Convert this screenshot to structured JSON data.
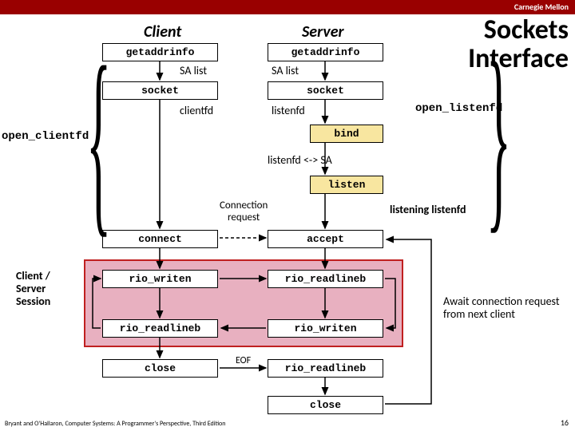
{
  "branding": "Carnegie Mellon",
  "title_line1": "Sockets",
  "title_line2": "Interface",
  "headers": {
    "client": "Client",
    "server": "Server"
  },
  "boxes": {
    "c_gai": "getaddrinfo",
    "s_gai": "getaddrinfo",
    "c_sock": "socket",
    "s_sock": "socket",
    "c_connect": "connect",
    "s_bind": "bind",
    "s_listen": "listen",
    "s_accept": "accept",
    "c_writen": "rio_writen",
    "s_readline1": "rio_readlineb",
    "c_readline": "rio_readlineb",
    "s_writen": "rio_writen",
    "c_close": "close",
    "s_readline2": "rio_readlineb",
    "s_close": "close"
  },
  "labels": {
    "sa_list_c": "SA list",
    "sa_list_s": "SA list",
    "clientfd": "clientfd",
    "listenfd": "listenfd",
    "listenfd_sa": "listenfd <-> SA",
    "listening_listenfd": "listening listenfd",
    "conn_req": "Connection\nrequest",
    "eof": "EOF",
    "open_clientfd": "open_clientfd",
    "open_listenfd": "open_listenfd",
    "session": "Client /\nServer\nSession",
    "await": "Await connection request from next client"
  },
  "footer": "Bryant and O'Hallaron, Computer Systems: A Programmer's Perspective, Third Edition",
  "pagenum": "16"
}
